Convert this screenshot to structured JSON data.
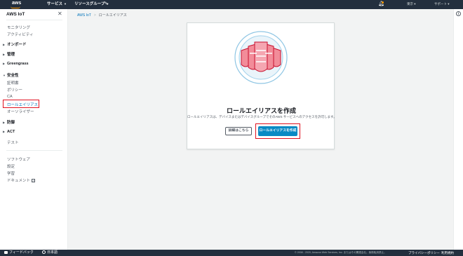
{
  "topnav": {
    "logo": "aws",
    "services": "サービス",
    "resource_groups": "リソースグループ",
    "region": "東京",
    "support": "サポート"
  },
  "sidebar": {
    "title": "AWS IoT",
    "items": [
      {
        "label": "モニタリング"
      },
      {
        "label": "アクティビティ"
      },
      {
        "label": "オンボード"
      },
      {
        "label": "管理"
      },
      {
        "label": "Greengrass"
      },
      {
        "label": "安全性"
      },
      {
        "label": "証明書"
      },
      {
        "label": "ポリシー"
      },
      {
        "label": "CA"
      },
      {
        "label": "ロールエイリアス"
      },
      {
        "label": "オーソライザー"
      },
      {
        "label": "防御"
      },
      {
        "label": "ACT"
      },
      {
        "label": "テスト"
      },
      {
        "label": "ソフトウェア"
      },
      {
        "label": "設定"
      },
      {
        "label": "学習"
      },
      {
        "label": "ドキュメント"
      }
    ]
  },
  "breadcrumb": {
    "root": "AWS IoT",
    "current": "ロールエイリアス"
  },
  "card": {
    "heading": "ロールエイリアスを作成",
    "description": "ロールエイリアスは、デバイスまたはデバイスグループでそのAWS サービスへのアクセスを許可します。",
    "learn_more": "詳細はこちら",
    "create": "ロールエイリアスを作成"
  },
  "footer": {
    "feedback": "フィードバック",
    "language": "日本語",
    "copyright": "© 2008 - 2020, Amazon Web Services, Inc. またはその関連会社。無断転用禁止。",
    "privacy": "プライバシーポリシー",
    "terms": "利用規約"
  },
  "colors": {
    "nav": "#232f3e",
    "accent": "#ff9900",
    "primary_button": "#0a8ac4",
    "link": "#0073bb",
    "highlight": "#e0111f"
  }
}
